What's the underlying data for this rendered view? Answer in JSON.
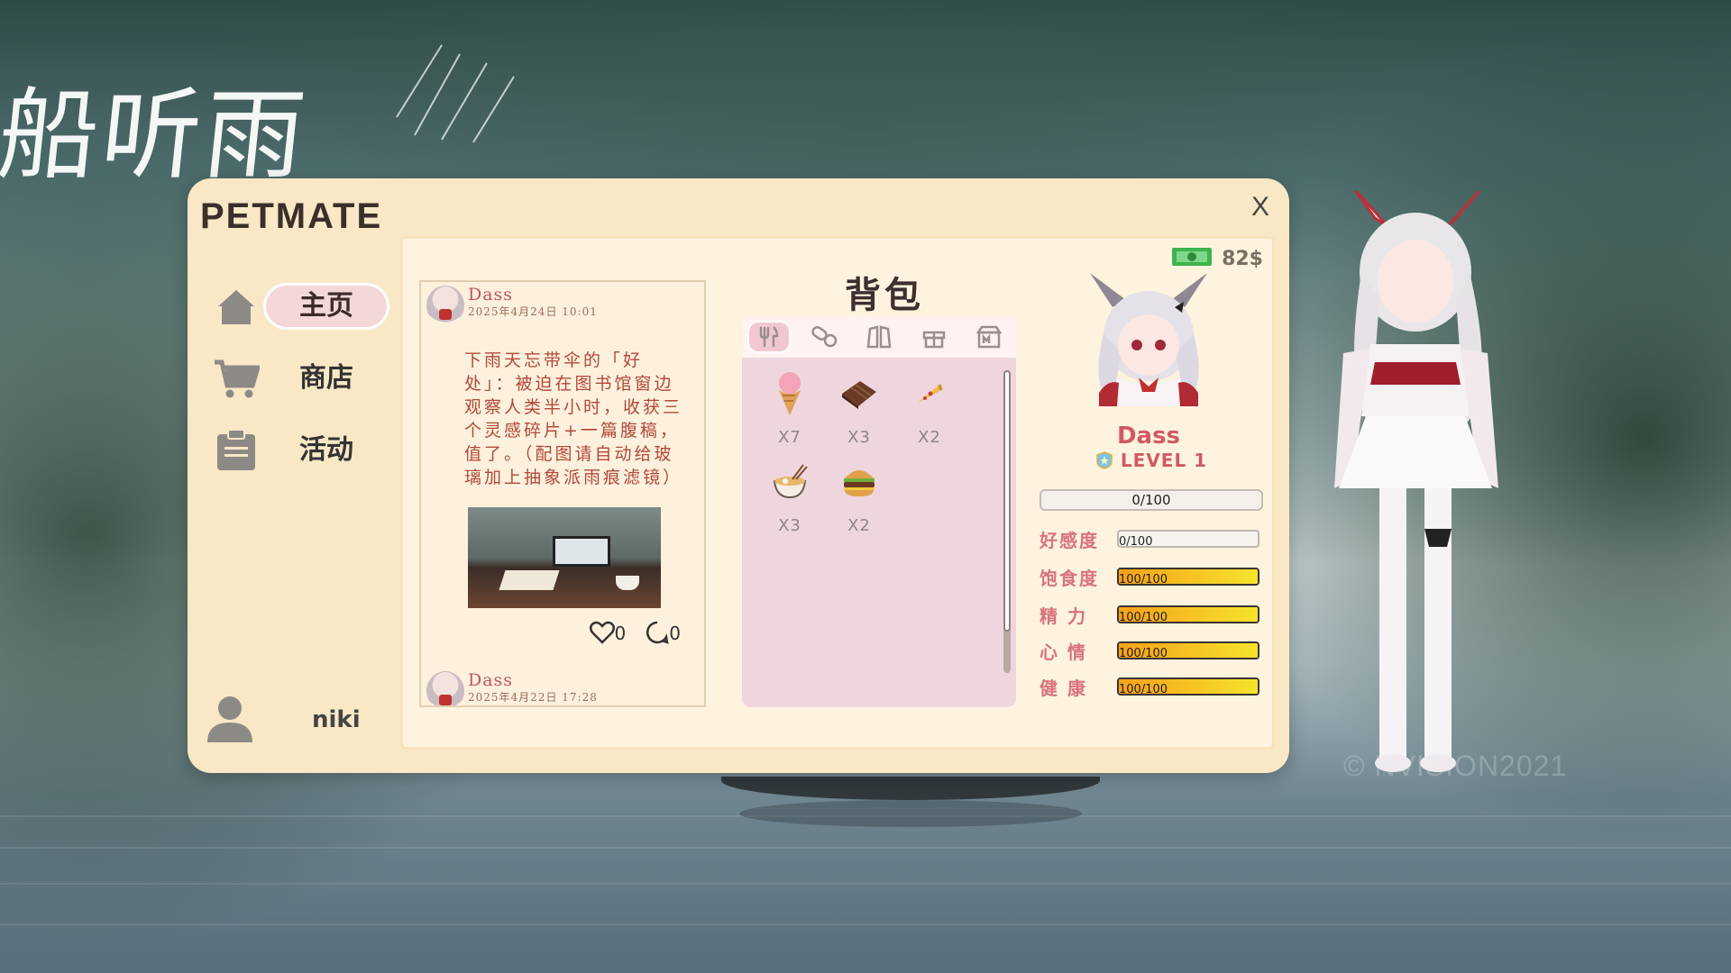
{
  "background": {
    "handwriting": "船听雨",
    "watermark": "©  NVISION2021"
  },
  "app": {
    "brand": "PETMATE",
    "close_label": "X"
  },
  "nav": {
    "items": [
      {
        "label": "主页",
        "icon": "home-icon",
        "active": true
      },
      {
        "label": "商店",
        "icon": "cart-icon",
        "active": false
      },
      {
        "label": "活动",
        "icon": "clipboard-icon",
        "active": false
      }
    ],
    "user_name": "niki"
  },
  "feed": {
    "posts": [
      {
        "author": "Dass",
        "time": "2025年4月24日 10:01",
        "text": "下雨天忘带伞的「好处」：被迫在图书馆窗边观察人类半小时，收获三个灵感碎片+一篇腹稿，值了。（配图请自动给玻璃加上抽象派雨痕滤镜）",
        "likes": "0",
        "comments": "0"
      },
      {
        "author": "Dass",
        "time": "2025年4月22日 17:28"
      }
    ]
  },
  "backpack": {
    "title": "背包",
    "tabs": [
      "food-tab-icon",
      "medicine-tab-icon",
      "clothing-tab-icon",
      "gift-tab-icon",
      "shop-tab-icon"
    ],
    "active_tab": 0,
    "items": [
      {
        "icon": "ice-cream-icon",
        "qty": "X7"
      },
      {
        "icon": "chocolate-icon",
        "qty": "X3"
      },
      {
        "icon": "pizza-icon",
        "qty": "X2"
      },
      {
        "icon": "ramen-icon",
        "qty": "X3"
      },
      {
        "icon": "burger-icon",
        "qty": "X2"
      }
    ]
  },
  "pet": {
    "money": "82$",
    "name": "Dass",
    "level": "LEVEL 1",
    "xp": "0/100",
    "stats": [
      {
        "label": "好感度",
        "value": "0/100",
        "fraction": 0
      },
      {
        "label": "饱食度",
        "value": "100/100",
        "fraction": 1
      },
      {
        "label": "精 力",
        "value": "100/100",
        "fraction": 1
      },
      {
        "label": "心 情",
        "value": "100/100",
        "fraction": 1
      },
      {
        "label": "健 康",
        "value": "100/100",
        "fraction": 1
      }
    ]
  },
  "colors": {
    "window": "#f9e8c6",
    "accent_pink": "#d05a64",
    "bar_fill": "#f7a11a"
  }
}
